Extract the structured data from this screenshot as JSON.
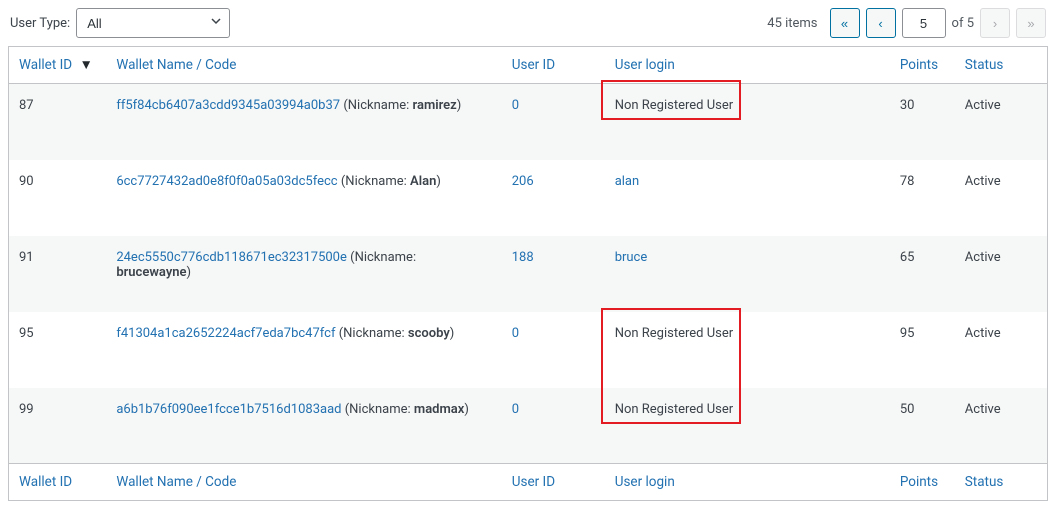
{
  "filter": {
    "label": "User Type:",
    "selected": "All"
  },
  "pagination": {
    "count_text": "45 items",
    "current": "5",
    "total_text": "of 5",
    "first": "«",
    "prev": "‹",
    "next": "›",
    "last": "»"
  },
  "columns": {
    "wallet_id": "Wallet ID",
    "wallet_name": "Wallet Name / Code",
    "user_id": "User ID",
    "user_login": "User login",
    "points": "Points",
    "status": "Status"
  },
  "nick_prefix": " (Nickname: ",
  "nick_suffix": ")",
  "non_registered": "Non Registered User",
  "rows": [
    {
      "wallet_id": "87",
      "code": "ff5f84cb6407a3cdd9345a03994a0b37",
      "nickname": "ramirez",
      "user_id": "0",
      "login": null,
      "points": "30",
      "status": "Active"
    },
    {
      "wallet_id": "90",
      "code": "6cc7727432ad0e8f0f0a05a03dc5fecc",
      "nickname": "Alan",
      "user_id": "206",
      "login": "alan",
      "points": "78",
      "status": "Active"
    },
    {
      "wallet_id": "91",
      "code": "24ec5550c776cdb118671ec32317500e",
      "nickname": "brucewayne",
      "user_id": "188",
      "login": "bruce",
      "points": "65",
      "status": "Active"
    },
    {
      "wallet_id": "95",
      "code": "f41304a1ca2652224acf7eda7bc47fcf",
      "nickname": "scooby",
      "user_id": "0",
      "login": null,
      "points": "95",
      "status": "Active"
    },
    {
      "wallet_id": "99",
      "code": "a6b1b76f090ee1fcce1b7516d1083aad",
      "nickname": "madmax",
      "user_id": "0",
      "login": null,
      "points": "50",
      "status": "Active"
    }
  ]
}
